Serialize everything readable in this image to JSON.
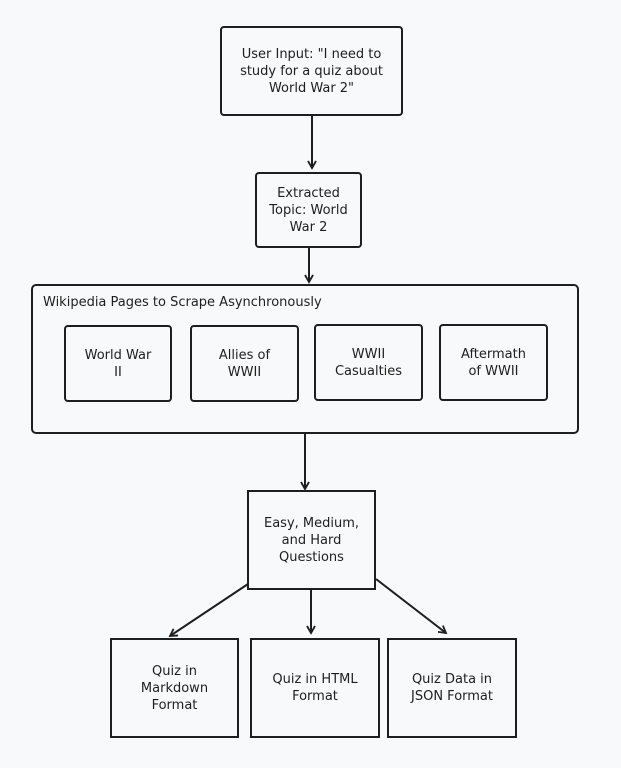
{
  "diagram": {
    "nodes": {
      "user_input": "User Input: \"I need to\nstudy for a quiz about\nWorld War 2\"",
      "topic": "Extracted\nTopic: World\nWar 2",
      "questions": "Easy, Medium,\nand Hard\nQuestions",
      "output_markdown": "Quiz in\nMarkdown\nFormat",
      "output_html": "Quiz in HTML\nFormat",
      "output_json": "Quiz Data in\nJSON Format"
    },
    "group": {
      "title": "Wikipedia Pages to Scrape Asynchronously",
      "pages": [
        "World War\nII",
        "Allies of\nWWII",
        "WWII\nCasualties",
        "Aftermath\nof WWII"
      ]
    },
    "edges": [
      {
        "from": "user_input",
        "to": "topic"
      },
      {
        "from": "topic",
        "to": "group"
      },
      {
        "from": "group",
        "to": "questions"
      },
      {
        "from": "questions",
        "to": "output_markdown"
      },
      {
        "from": "questions",
        "to": "output_html"
      },
      {
        "from": "questions",
        "to": "output_json"
      }
    ]
  }
}
